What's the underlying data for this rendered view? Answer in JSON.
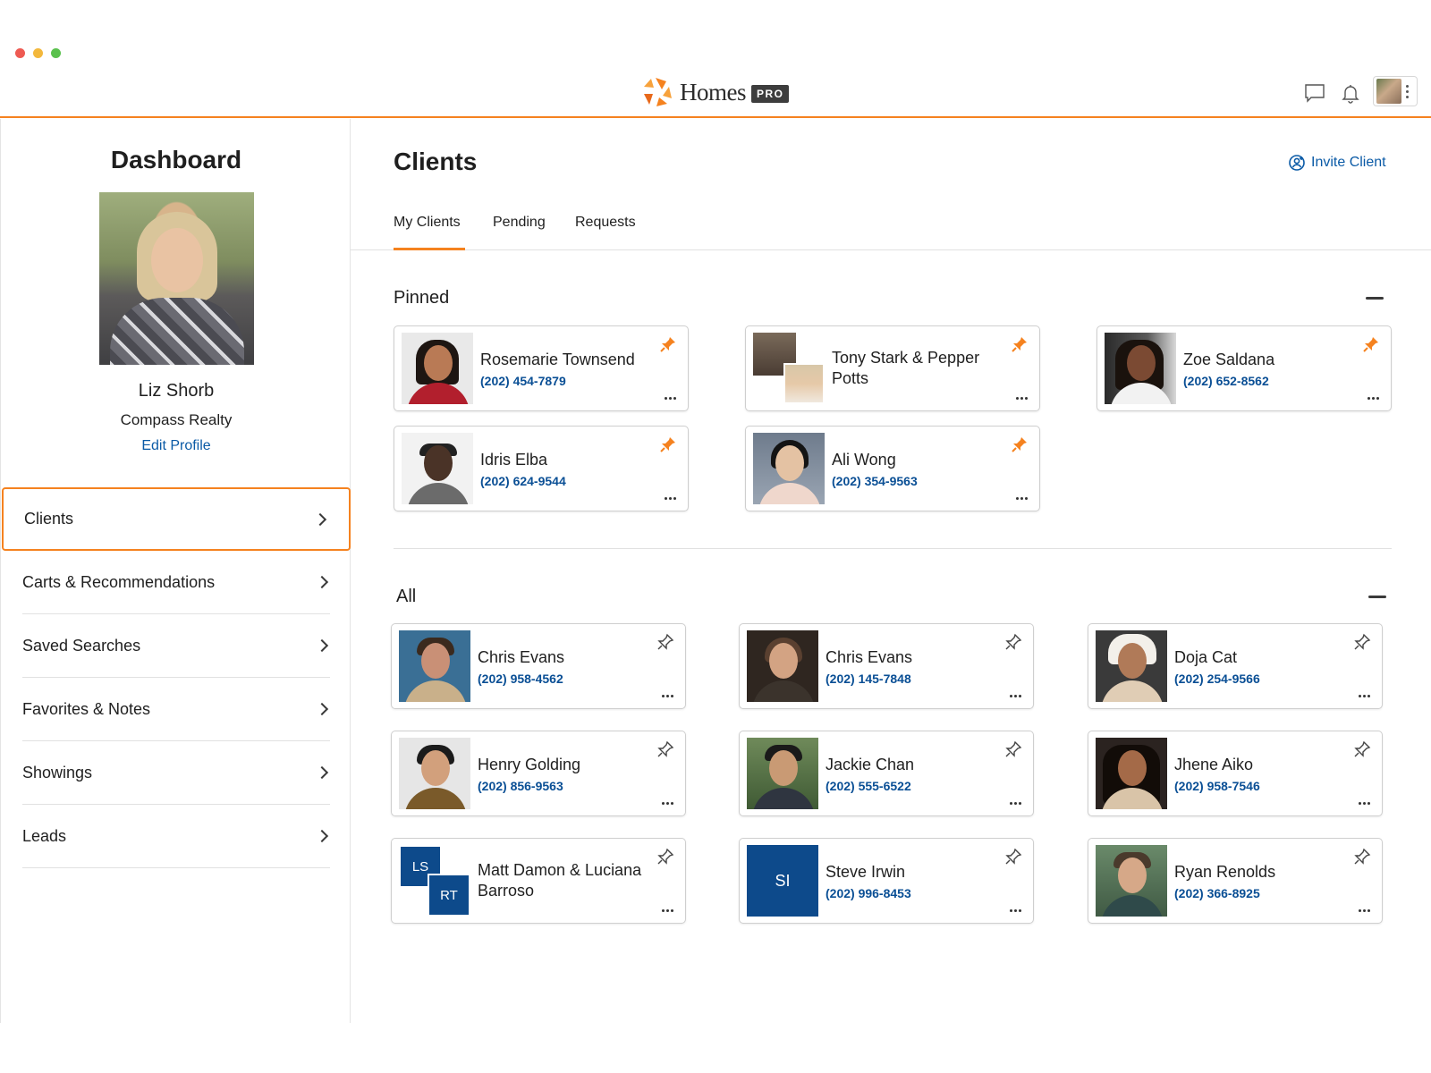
{
  "window": {
    "dot_colors": [
      "#ee5a52",
      "#f3b83c",
      "#5ac14d"
    ]
  },
  "header": {
    "logo_text": "Homes",
    "logo_badge": "PRO",
    "icons": [
      "chat-icon",
      "bell-icon"
    ],
    "accent_color": "#f5821f"
  },
  "sidebar": {
    "title": "Dashboard",
    "profile": {
      "name": "Liz Shorb",
      "company": "Compass Realty",
      "edit_label": "Edit Profile"
    },
    "items": [
      {
        "label": "Clients",
        "active": true
      },
      {
        "label": "Carts & Recommendations",
        "active": false
      },
      {
        "label": "Saved Searches",
        "active": false
      },
      {
        "label": "Favorites & Notes",
        "active": false
      },
      {
        "label": "Showings",
        "active": false
      },
      {
        "label": "Leads",
        "active": false
      }
    ]
  },
  "main": {
    "title": "Clients",
    "invite_label": "Invite Client",
    "tabs": [
      {
        "label": "My Clients",
        "active": true
      },
      {
        "label": "Pending",
        "active": false
      },
      {
        "label": "Requests",
        "active": false
      }
    ],
    "pinned": {
      "heading": "Pinned",
      "clients": [
        {
          "name": "Rosemarie Townsend",
          "phone": "(202) 454-7879",
          "pinned": true
        },
        {
          "name": "Tony Stark & Pepper Potts",
          "phone": "",
          "pinned": true
        },
        {
          "name": "Zoe Saldana",
          "phone": "(202) 652-8562",
          "pinned": true
        },
        {
          "name": "Idris Elba",
          "phone": "(202) 624-9544",
          "pinned": true
        },
        {
          "name": "Ali Wong",
          "phone": "(202) 354-9563",
          "pinned": true
        }
      ]
    },
    "all": {
      "heading": "All",
      "clients": [
        {
          "name": "Chris Evans",
          "phone": "(202) 958-4562",
          "pinned": false
        },
        {
          "name": "Chris Evans",
          "phone": "(202) 145-7848",
          "pinned": false
        },
        {
          "name": "Doja Cat",
          "phone": "(202) 254-9566",
          "pinned": false
        },
        {
          "name": "Henry Golding",
          "phone": "(202) 856-9563",
          "pinned": false
        },
        {
          "name": "Jackie Chan",
          "phone": "(202) 555-6522",
          "pinned": false
        },
        {
          "name": "Jhene Aiko",
          "phone": "(202) 958-7546",
          "pinned": false
        },
        {
          "name": "Matt Damon & Luciana Barroso",
          "phone": "",
          "pinned": false,
          "initials": [
            "LS",
            "RT"
          ]
        },
        {
          "name": "Steve Irwin",
          "phone": "(202) 996-8453",
          "pinned": false,
          "initials": [
            "SI"
          ]
        },
        {
          "name": "Ryan Renolds",
          "phone": "(202) 366-8925",
          "pinned": false
        }
      ]
    }
  },
  "colors": {
    "accent": "#f5821f",
    "link": "#0a5aa6",
    "phone": "#0a4f95",
    "initials_bg": "#0d4a8b"
  }
}
